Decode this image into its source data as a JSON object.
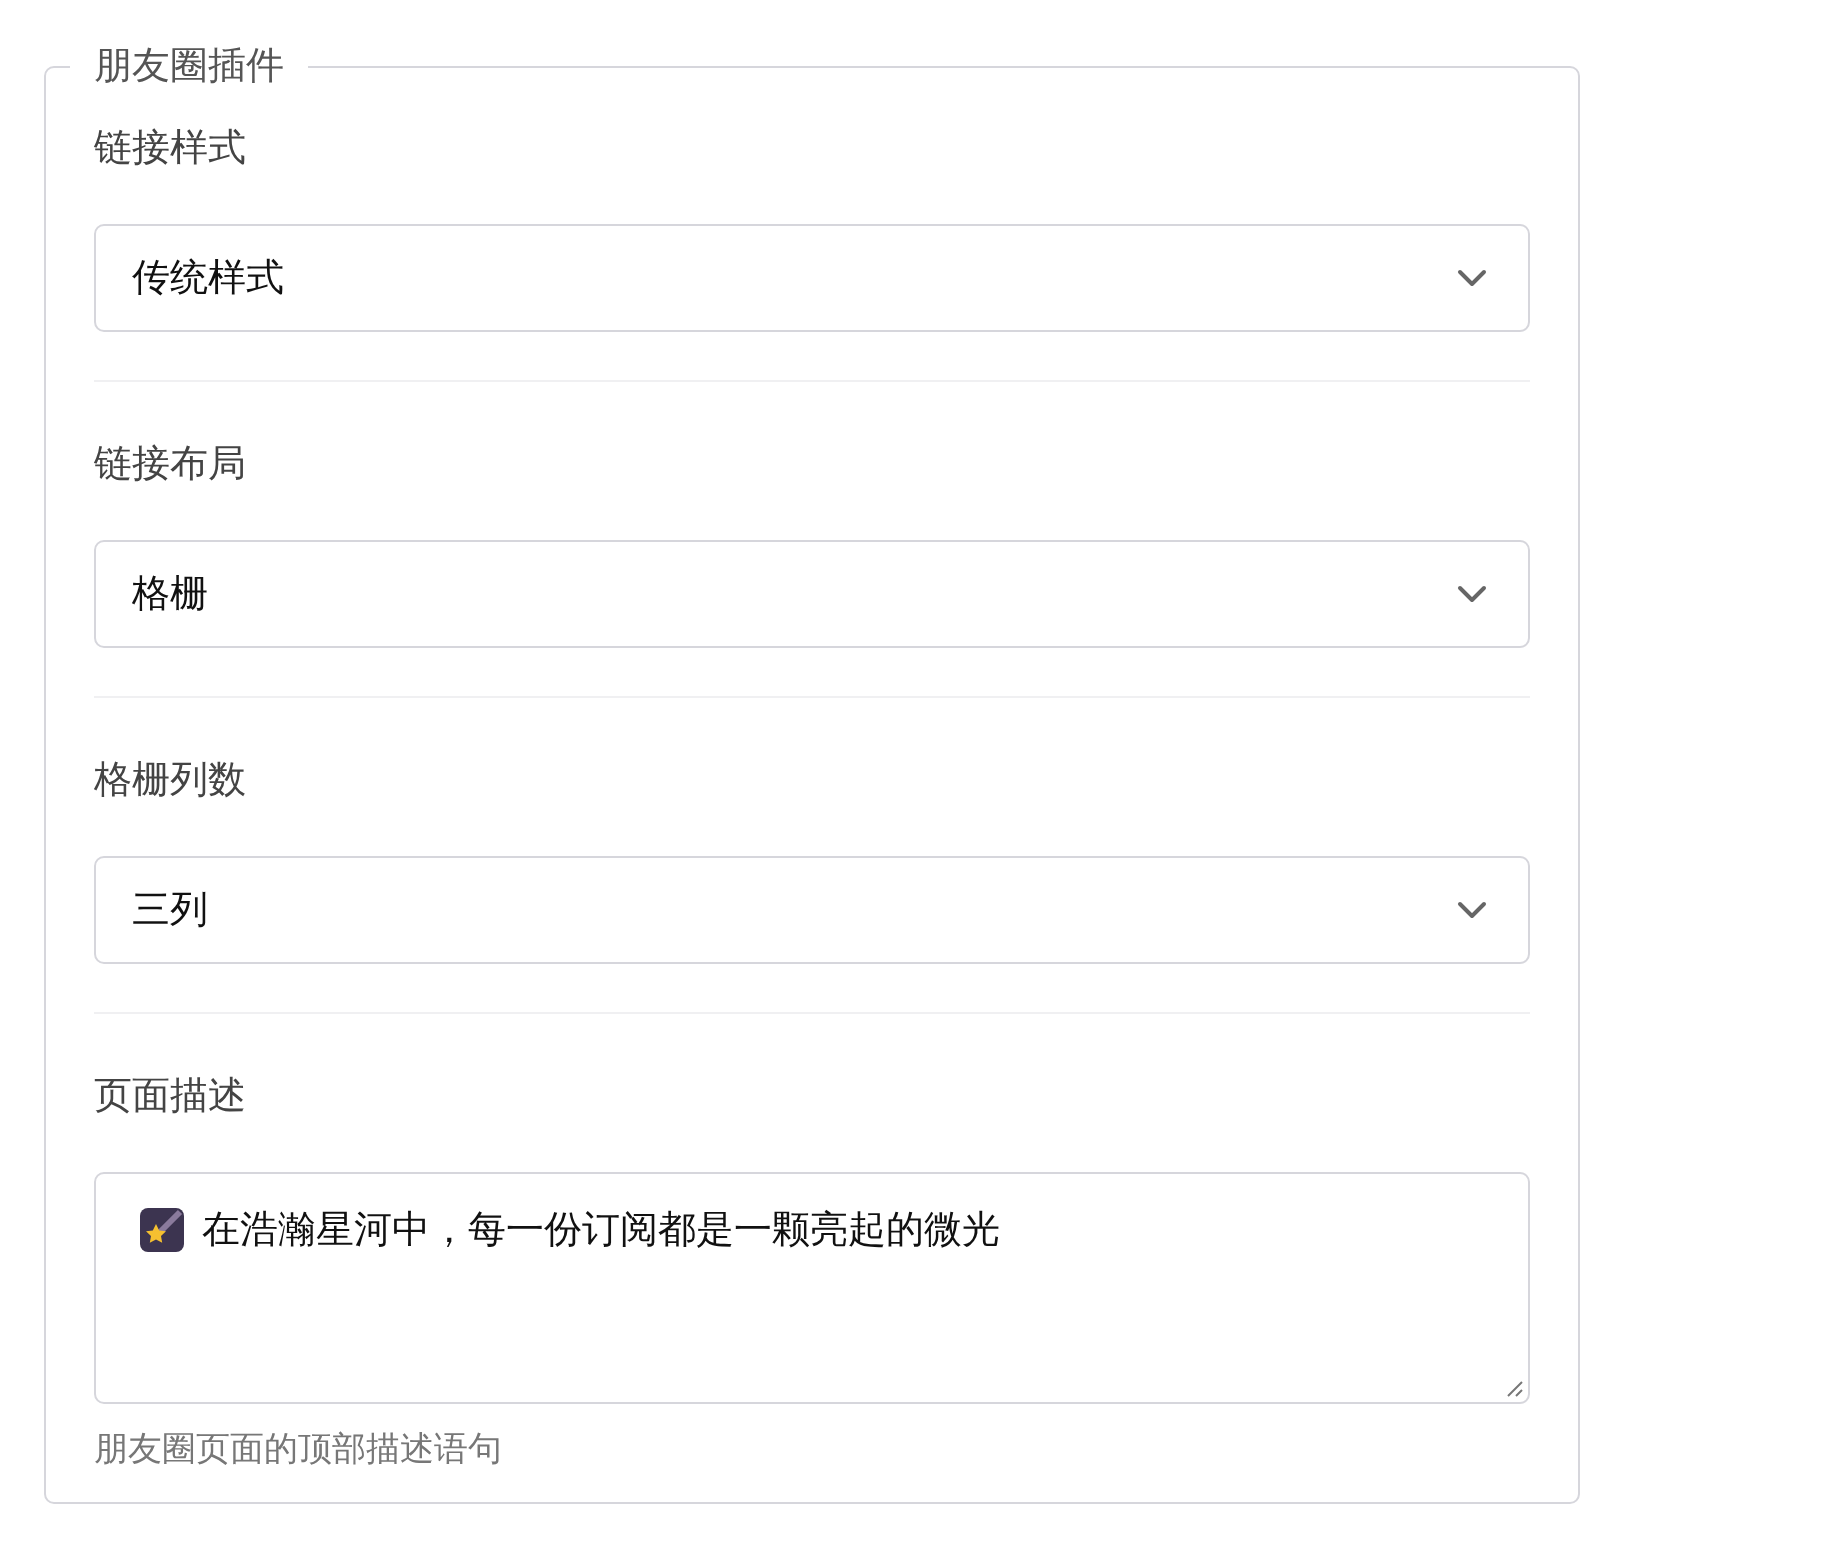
{
  "panel": {
    "title": "朋友圈插件"
  },
  "fields": [
    {
      "kind": "select",
      "label": "链接样式",
      "value": "传统样式"
    },
    {
      "kind": "select",
      "label": "链接布局",
      "value": "格栅"
    },
    {
      "kind": "select",
      "label": "格栅列数",
      "value": "三列"
    },
    {
      "kind": "textarea",
      "label": "页面描述",
      "value": "在浩瀚星河中，每一份订阅都是一颗亮起的微光",
      "help": "朋友圈页面的顶部描述语句"
    }
  ]
}
